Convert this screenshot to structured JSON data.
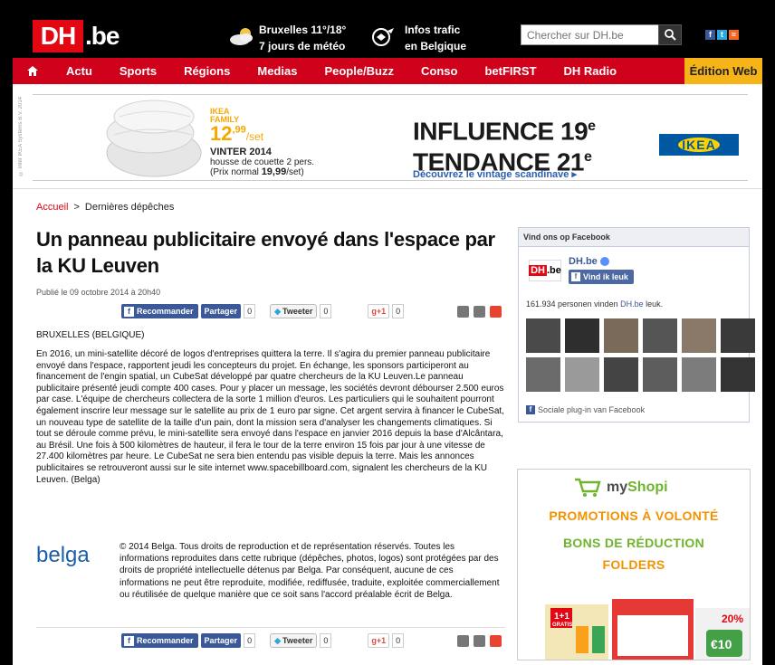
{
  "header": {
    "logo_prefix": "DH",
    "logo_suffix": ".be",
    "weather_line1": "Bruxelles  11°/18°",
    "weather_line2": "7 jours de météo",
    "traffic_line1": "Infos trafic",
    "traffic_line2": "en Belgique",
    "search_placeholder": "Chercher sur DH.be"
  },
  "nav": {
    "items": [
      "Actu",
      "Sports",
      "Régions",
      "Medias",
      "People/Buzz",
      "Conso",
      "betFIRST",
      "DH Radio"
    ],
    "edition": "Édition Web"
  },
  "banner": {
    "vertical_credit": "© Inter IKEA Systems B.V. 2014",
    "ikea_family_1": "IKEA",
    "ikea_family_2": "FAMILY",
    "price_main": "12",
    "price_cents": ",99",
    "price_unit": "/set",
    "product_name": "VINTER 2014",
    "product_desc": "housse de couette 2 pers.",
    "normal_price_label": "(Prix normal ",
    "normal_price_value": "19,99",
    "normal_price_unit": "/set)",
    "influence_1": "INFLUENCE 19",
    "influence_1_sup": "e",
    "influence_2": "TENDANCE 21",
    "influence_2_sup": "e",
    "cta": "Découvrez le vintage scandinave ▸",
    "ikea_logo": "IKEA"
  },
  "breadcrumb": {
    "home": "Accueil",
    "separator": ">",
    "current": "Dernières dépêches"
  },
  "article": {
    "title": "Un panneau publicitaire envoyé dans l'espace par la KU Leuven",
    "published": "Publié le 09 octobre 2014 à 20h40",
    "dateline": "BRUXELLES (BELGIQUE)",
    "body": "En 2016, un mini-satellite décoré de logos d'entreprises quittera la terre. Il s'agira du premier panneau publicitaire envoyé dans l'espace, rapportent jeudi les concepteurs du projet. En échange, les sponsors participeront au financement de l'engin spatial, un CubeSat développé par quatre chercheurs de la KU Leuven.Le panneau publicitaire présenté jeudi compte 400 cases. Pour y placer un message, les sociétés devront débourser 2.500 euros par case. L'équipe de chercheurs collectera de la sorte 1 million d'euros. Les particuliers qui le souhaitent pourront également inscrire leur message sur le satellite au prix de 1 euro par signe. Cet argent servira à financer le CubeSat, un nouveau type de satellite de la taille d'un pain, dont la mission sera d'analyser les changements climatiques. Si tout se déroule comme prévu, le mini-satellite sera envoyé dans l'espace en janvier 2016 depuis la base d'Alcântara, au Brésil. Une fois à 500 kilomètres de hauteur, il fera le tour de la terre environ 15 fois par jour à une vitesse de 27.400 kilomètres par heure. Le CubeSat ne sera bien entendu pas visible depuis la terre. Mais les annonces publicitaires se retrouveront aussi sur le site internet www.spacebillboard.com, signalent les chercheurs de la KU Leuven. (Belga)",
    "agency_logo": "belga",
    "copyright": "© 2014 Belga. Tous droits de reproduction et de représentation réservés. Toutes les informations reproduites dans cette rubrique (dépêches, photos, logos) sont protégées par des droits de propriété intellectuelle détenus par Belga. Par conséquent, aucune de ces informations ne peut être reproduite, modifiée, rediffusée, traduite, exploitée commerciallement ou réutilisée de quelque manière que ce soit sans l'accord préalable écrit de Belga."
  },
  "share": {
    "recommend": "Recommander",
    "share": "Partager",
    "share_count": "0",
    "tweet": "Tweeter",
    "tweet_count": "0",
    "gplus": "+1",
    "gplus_count": "0"
  },
  "facebook_widget": {
    "header": "Vind ons op Facebook",
    "page_name": "DH.be",
    "like_button": "Vind ik leuk",
    "fans_count": "161.934",
    "fans_text_before": " personen vinden ",
    "fans_text_link": "DH.be",
    "fans_text_after": " leuk.",
    "plugin_label": "Sociale plug-in van Facebook"
  },
  "shopi_ad": {
    "brand_prefix": "my",
    "brand_suffix": "Shopi",
    "line1": "PROMOTIONS À VOLONTÉ",
    "line2": "BONS DE RÉDUCTION",
    "line3": "FOLDERS",
    "promo_badge": "1+1",
    "promo_badge_sub": "GRATIS",
    "promo_pct": "20%",
    "promo_price": "€10",
    "colors": {
      "orange": "#f39200",
      "green": "#6fb42c"
    }
  },
  "colors": {
    "brand_red": "#e30613",
    "nav_red": "#d0021b",
    "edition_yellow": "#f6b418",
    "facebook_blue": "#3b5998",
    "ikea_blue": "#0058a3",
    "ikea_yellow": "#fdd100"
  }
}
